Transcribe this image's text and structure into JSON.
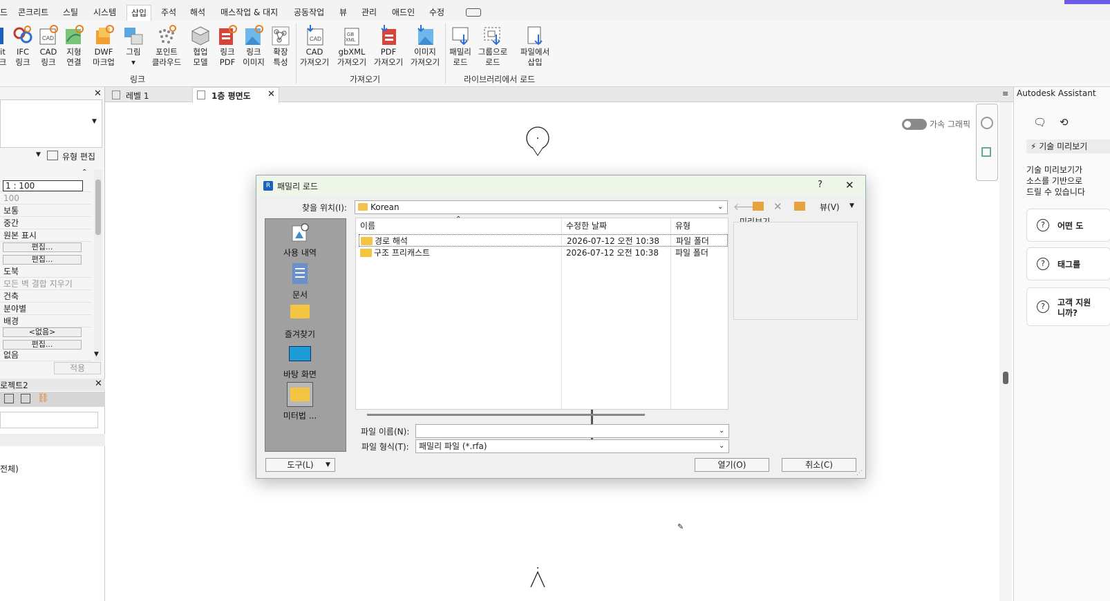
{
  "menu": {
    "tabs": [
      "드",
      "콘크리트",
      "스틸",
      "시스템",
      "삽입",
      "주석",
      "해석",
      "매스작업 & 대지",
      "공동작업",
      "뷰",
      "관리",
      "애드인",
      "수정"
    ],
    "active": "삽입"
  },
  "ribbon": {
    "buttons": [
      {
        "l1": "it",
        "l2": "크"
      },
      {
        "l1": "IFC",
        "l2": "링크"
      },
      {
        "l1": "CAD",
        "l2": "링크"
      },
      {
        "l1": "지형",
        "l2": "연결"
      },
      {
        "l1": "DWF",
        "l2": "마크업"
      },
      {
        "l1": "그림",
        "l2": "▾"
      },
      {
        "l1": "포인트",
        "l2": "클라우드"
      },
      {
        "l1": "협업",
        "l2": "모델"
      },
      {
        "l1": "링크",
        "l2": "PDF"
      },
      {
        "l1": "링크",
        "l2": "이미지"
      },
      {
        "l1": "확장",
        "l2": "특성"
      },
      {
        "l1": "CAD",
        "l2": "가져오기"
      },
      {
        "l1": "gbXML",
        "l2": "가져오기"
      },
      {
        "l1": "PDF",
        "l2": "가져오기"
      },
      {
        "l1": "이미지",
        "l2": "가져오기"
      },
      {
        "l1": "패밀리",
        "l2": "로드"
      },
      {
        "l1": "그룹으로",
        "l2": "로드"
      },
      {
        "l1": "파일에서",
        "l2": "삽입"
      }
    ],
    "groups": [
      "링크",
      "가져오기",
      "라이브러리에서 로드"
    ]
  },
  "properties": {
    "type_edit": "유형 편집",
    "rows": [
      "1 : 100",
      "100",
      "보통",
      "중간",
      "원본 표시",
      "편집...",
      "편집...",
      "도북",
      "모든 벽 결합 지우기",
      "건축",
      "분야별",
      "배경",
      "<없음>",
      "편집...",
      "없음"
    ],
    "apply": "적용"
  },
  "project": {
    "title": "로젝트2",
    "item": "전체)"
  },
  "view_tabs": [
    "레벨 1",
    "1층 평면도"
  ],
  "canvas": {
    "accel_label": "가속 그래픽"
  },
  "assistant": {
    "title": "Autodesk Assistant",
    "tech_preview": "기술 미리보기",
    "description": [
      "기술 미리보기가",
      "소스를 기반으로",
      "드릴 수 있습니다"
    ],
    "cards": [
      "어떤 도",
      "태그를",
      "고객 지원"
    ],
    "card3_line2": "니까?"
  },
  "dialog": {
    "title": "패밀리 로드",
    "help": "?",
    "close": "✕",
    "lookin_label": "찾을 위치(I):",
    "lookin_value": "Korean",
    "view_label": "뷰(V)",
    "places": [
      "사용 내역",
      "문서",
      "즐겨찾기",
      "바탕 화면",
      "미터법 ..."
    ],
    "columns": [
      "이름",
      "수정한 날짜",
      "유형"
    ],
    "files": [
      {
        "name": "경로 해석",
        "date": "2026-07-12 오전 10:38",
        "type": "파일 폴더"
      },
      {
        "name": "구조 프리캐스트",
        "date": "2026-07-12 오전 10:38",
        "type": "파일 폴더"
      }
    ],
    "preview_label": "미리보기",
    "filename_label": "파일 이름(N):",
    "filename_value": "",
    "filetype_label": "파일 형식(T):",
    "filetype_value": "패밀리 파일 (*.rfa)",
    "tools_button": "도구(L)",
    "open_button": "열기(O)",
    "cancel_button": "취소(C)"
  },
  "colors": {
    "accent": "#2b6fd6",
    "places_bg": "#a0a0a0",
    "title_bg": "#eef6ea"
  }
}
